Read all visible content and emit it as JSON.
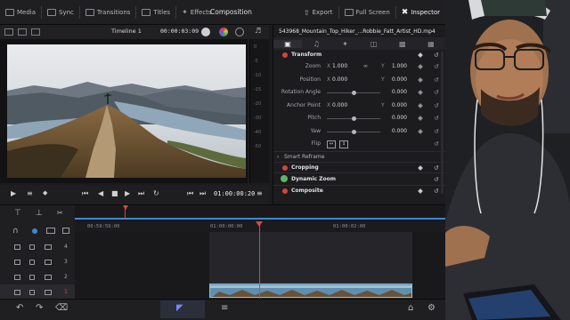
{
  "topbar": {
    "media": "Media",
    "sync": "Sync",
    "transitions": "Transitions",
    "titles": "Titles",
    "effects": "Effects",
    "center_title": "Composition",
    "export": "Export",
    "full_screen": "Full Screen",
    "inspector": "Inspector"
  },
  "viewer": {
    "timeline_name": "Timeline 1",
    "timecode_top": "00:00:03:09",
    "timecode_main": "01:00:00:20"
  },
  "inspector": {
    "file_name": "543968_Mountain_Top_Hiker_...Robbie_Fatt_Artist_HD.mp4",
    "transform": {
      "title": "Transform",
      "zoom": {
        "label": "Zoom",
        "x_label": "X",
        "x": "1.000",
        "y_label": "Y",
        "y": "1.000"
      },
      "position": {
        "label": "Position",
        "x_label": "X",
        "x": "0.000",
        "y_label": "Y",
        "y": "0.000"
      },
      "rotation": {
        "label": "Rotation Angle",
        "value": "0.000"
      },
      "anchor": {
        "label": "Anchor Point",
        "x_label": "X",
        "x": "0.000",
        "y_label": "Y",
        "y": "0.000"
      },
      "pitch": {
        "label": "Pitch",
        "value": "0.000"
      },
      "yaw": {
        "label": "Yaw",
        "value": "0.000"
      },
      "flip": {
        "label": "Flip"
      }
    },
    "smart_reframe": "Smart Reframe",
    "cropping": "Cropping",
    "dynamic_zoom": "Dynamic Zoom",
    "composite": "Composite"
  },
  "timeline": {
    "ruler": [
      "00:59:59:00",
      "01:00:00:00",
      "01:00:02:00"
    ],
    "tracks": [
      "4",
      "3",
      "2",
      "1"
    ]
  },
  "colors": {
    "accent_red": "#e0453d",
    "clip_blue": "#4e86a8",
    "led_green": "#5fb562"
  }
}
